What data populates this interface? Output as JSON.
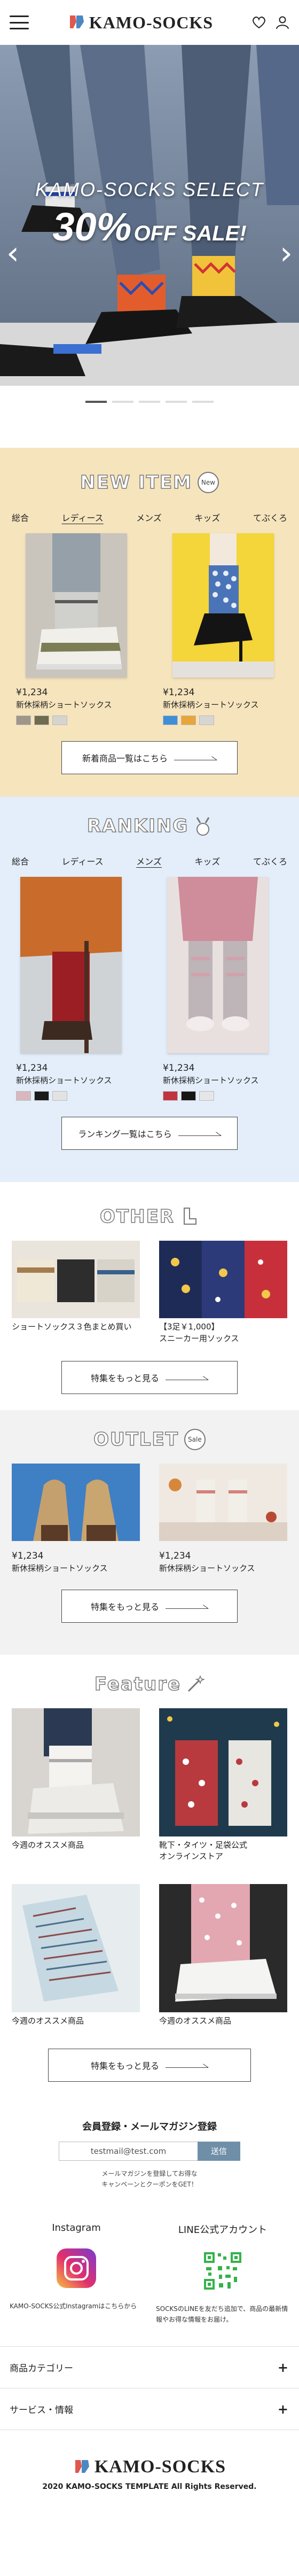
{
  "header": {
    "brand": "KAMO-SOCKS",
    "icons": [
      "menu-icon",
      "heart-icon",
      "user-icon"
    ]
  },
  "hero": {
    "title": "KAMO-SOCKS SELECT",
    "sale_big": "30%",
    "sale_small": "OFF SALE!",
    "slide_count": 5,
    "active_slide": 1
  },
  "new_item": {
    "title": "NEW ITEM",
    "badge": "New",
    "tabs": [
      "総合",
      "レディース",
      "メンズ",
      "キッズ",
      "てぶくろ"
    ],
    "active_tab": 1,
    "products": [
      {
        "price": "¥1,234",
        "name": "新休採柄ショートソックス",
        "swatches": [
          "#9e9688",
          "#6f6b4f",
          "#d6d4cf"
        ]
      },
      {
        "price": "¥1,234",
        "name": "新休採柄ショートソックス",
        "swatches": [
          "#3f8fd6",
          "#e8a53a",
          "#d7d6d3"
        ]
      }
    ],
    "more": "新着商品一覧はこちら"
  },
  "ranking": {
    "title": "RANKING",
    "tabs": [
      "総合",
      "レディース",
      "メンズ",
      "キッズ",
      "てぶくろ"
    ],
    "active_tab": 2,
    "products": [
      {
        "price": "¥1,234",
        "name": "新休採柄ショートソックス",
        "swatches": [
          "#d8b8be",
          "#1a1a1a",
          "#e3e3e3"
        ]
      },
      {
        "price": "¥1,234",
        "name": "新休採柄ショートソックス",
        "swatches": [
          "#c0343f",
          "#161616",
          "#e6e6e6"
        ]
      }
    ],
    "more": "ランキング一覧はこちら"
  },
  "other": {
    "title": "OTHER",
    "items": [
      {
        "caption": "ショートソックス３色まとめ買い"
      },
      {
        "caption": "【3足￥1,000】\nスニーカー用ソックス"
      }
    ],
    "more": "特集をもっと見る"
  },
  "outlet": {
    "title": "OUTLET",
    "badge": "Sale",
    "items": [
      {
        "price": "¥1,234",
        "name": "新休採柄ショートソックス"
      },
      {
        "price": "¥1,234",
        "name": "新休採柄ショートソックス"
      }
    ],
    "more": "特集をもっと見る"
  },
  "feature": {
    "title": "Feature",
    "items": [
      {
        "caption": "今週のオススメ商品"
      },
      {
        "caption": "靴下・タイツ・足袋公式\nオンラインストア"
      },
      {
        "caption": "今週のオススメ商品"
      },
      {
        "caption": "今週のオススメ商品"
      }
    ],
    "more": "特集をもっと見る"
  },
  "newsletter": {
    "title": "会員登録・メールマガジン登録",
    "placeholder": "testmail@test.com",
    "submit": "送信",
    "note": "メールマガジンを登録してお得な\nキャンペーンとクーポンをGET！"
  },
  "social": {
    "instagram_title": "Instagram",
    "instagram_text": "KAMO-SOCKS公式Instagramはこちらから",
    "line_title": "LINE公式アカウント",
    "line_text": "SOCKSのLINEを友だち追加で、商品の最新情報やお得な情報をお届け。"
  },
  "footer_menu": [
    {
      "label": "商品カテゴリー"
    },
    {
      "label": "サービス・情報"
    }
  ],
  "footer": {
    "brand": "KAMO-SOCKS",
    "copyright": "2020 KAMO-SOCKS TEMPLATE  All Rights Reserved."
  },
  "colors": {
    "new_item_bg": "#f6e4bd",
    "ranking_bg": "#e3eefa",
    "outlet_bg": "#f2f2f2",
    "submit_btn": "#6f8fa8"
  }
}
